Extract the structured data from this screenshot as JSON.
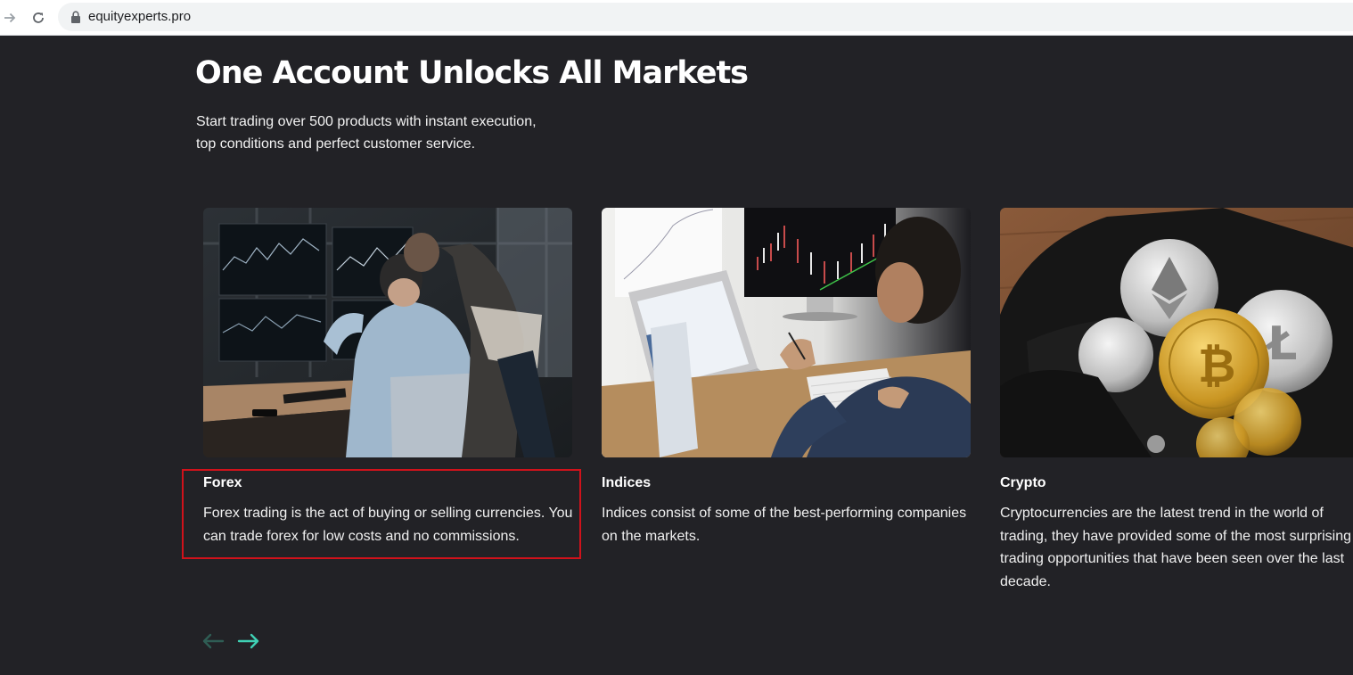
{
  "browser": {
    "url": "equityexperts.pro",
    "forward_icon": "arrow-right-icon",
    "reload_icon": "reload-icon",
    "lock_icon": "lock-icon"
  },
  "section": {
    "title": "One Account Unlocks All Markets",
    "subtitle_line1": "Start trading over 500 products with instant execution,",
    "subtitle_line2": "top conditions and perfect customer service."
  },
  "cards": [
    {
      "title": "Forex",
      "description": "Forex trading is the act of buying or selling currencies. You can trade forex for low costs and no commissions.",
      "image": "traders-at-monitors-photo"
    },
    {
      "title": "Indices",
      "description": "Indices consist of some of the best-performing companies on the markets.",
      "image": "man-analyzing-charts-photo"
    },
    {
      "title": "Crypto",
      "description": "Cryptocurrencies are the latest trend in the world of trading, they have provided some of the most surprising trading opportunities that have been seen over the last decade.",
      "image": "coins-in-wallet-photo"
    }
  ],
  "slider": {
    "prev_icon": "arrow-left-icon",
    "next_icon": "arrow-right-icon"
  },
  "colors": {
    "page_background": "#222226",
    "accent": "#3fd1b4",
    "highlight": "#d0121b"
  }
}
